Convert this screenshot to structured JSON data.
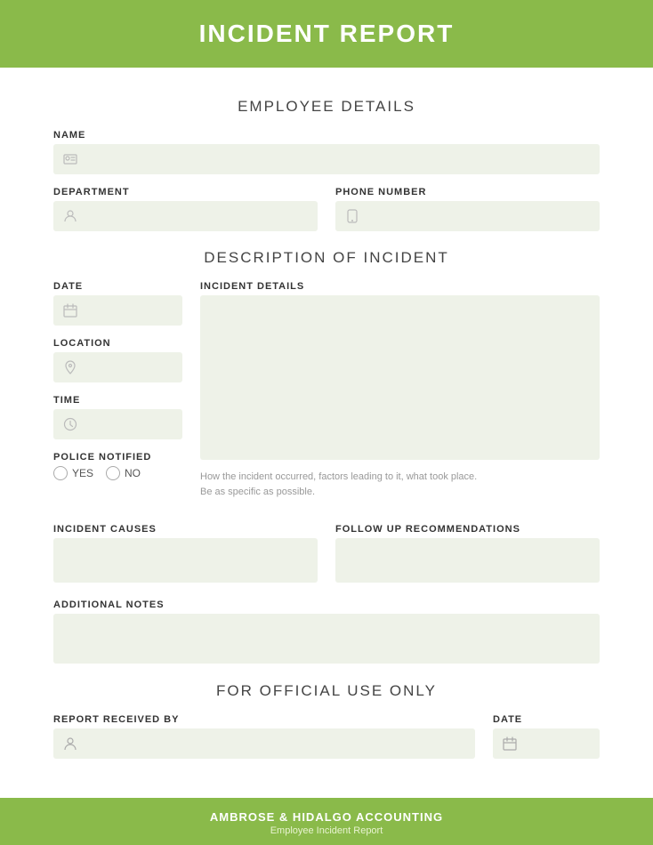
{
  "header": {
    "title": "INCIDENT REPORT"
  },
  "employee_details": {
    "section_title": "EMPLOYEE DETAILS",
    "name": {
      "label": "NAME",
      "placeholder": "",
      "icon": "person-icon"
    },
    "department": {
      "label": "DEPARTMENT",
      "placeholder": "",
      "icon": "department-icon"
    },
    "phone_number": {
      "label": "PHONE NUMBER",
      "placeholder": "",
      "icon": "phone-icon"
    }
  },
  "description": {
    "section_title": "DESCRIPTION OF INCIDENT",
    "date": {
      "label": "DATE",
      "placeholder": "",
      "icon": "calendar-icon"
    },
    "location": {
      "label": "LOCATION",
      "placeholder": "",
      "icon": "location-icon"
    },
    "time": {
      "label": "TIME",
      "placeholder": "",
      "icon": "clock-icon"
    },
    "police_notified": {
      "label": "POLICE NOTIFIED",
      "yes_label": "YES",
      "no_label": "NO"
    },
    "incident_details": {
      "label": "INCIDENT DETAILS",
      "hint": "How the incident occurred, factors leading to it, what took place.\nBe as specific as possible."
    },
    "incident_causes": {
      "label": "INCIDENT CAUSES"
    },
    "follow_up": {
      "label": "FOLLOW UP RECOMMENDATIONS"
    },
    "additional_notes": {
      "label": "ADDITIONAL NOTES"
    }
  },
  "official_use": {
    "section_title": "FOR OFFICIAL USE ONLY",
    "report_received_by": {
      "label": "REPORT RECEIVED BY",
      "icon": "person-icon"
    },
    "date": {
      "label": "DATE",
      "icon": "calendar-icon"
    }
  },
  "footer": {
    "company": "AMBROSE & HIDALGO ACCOUNTING",
    "subtitle": "Employee Incident Report"
  }
}
